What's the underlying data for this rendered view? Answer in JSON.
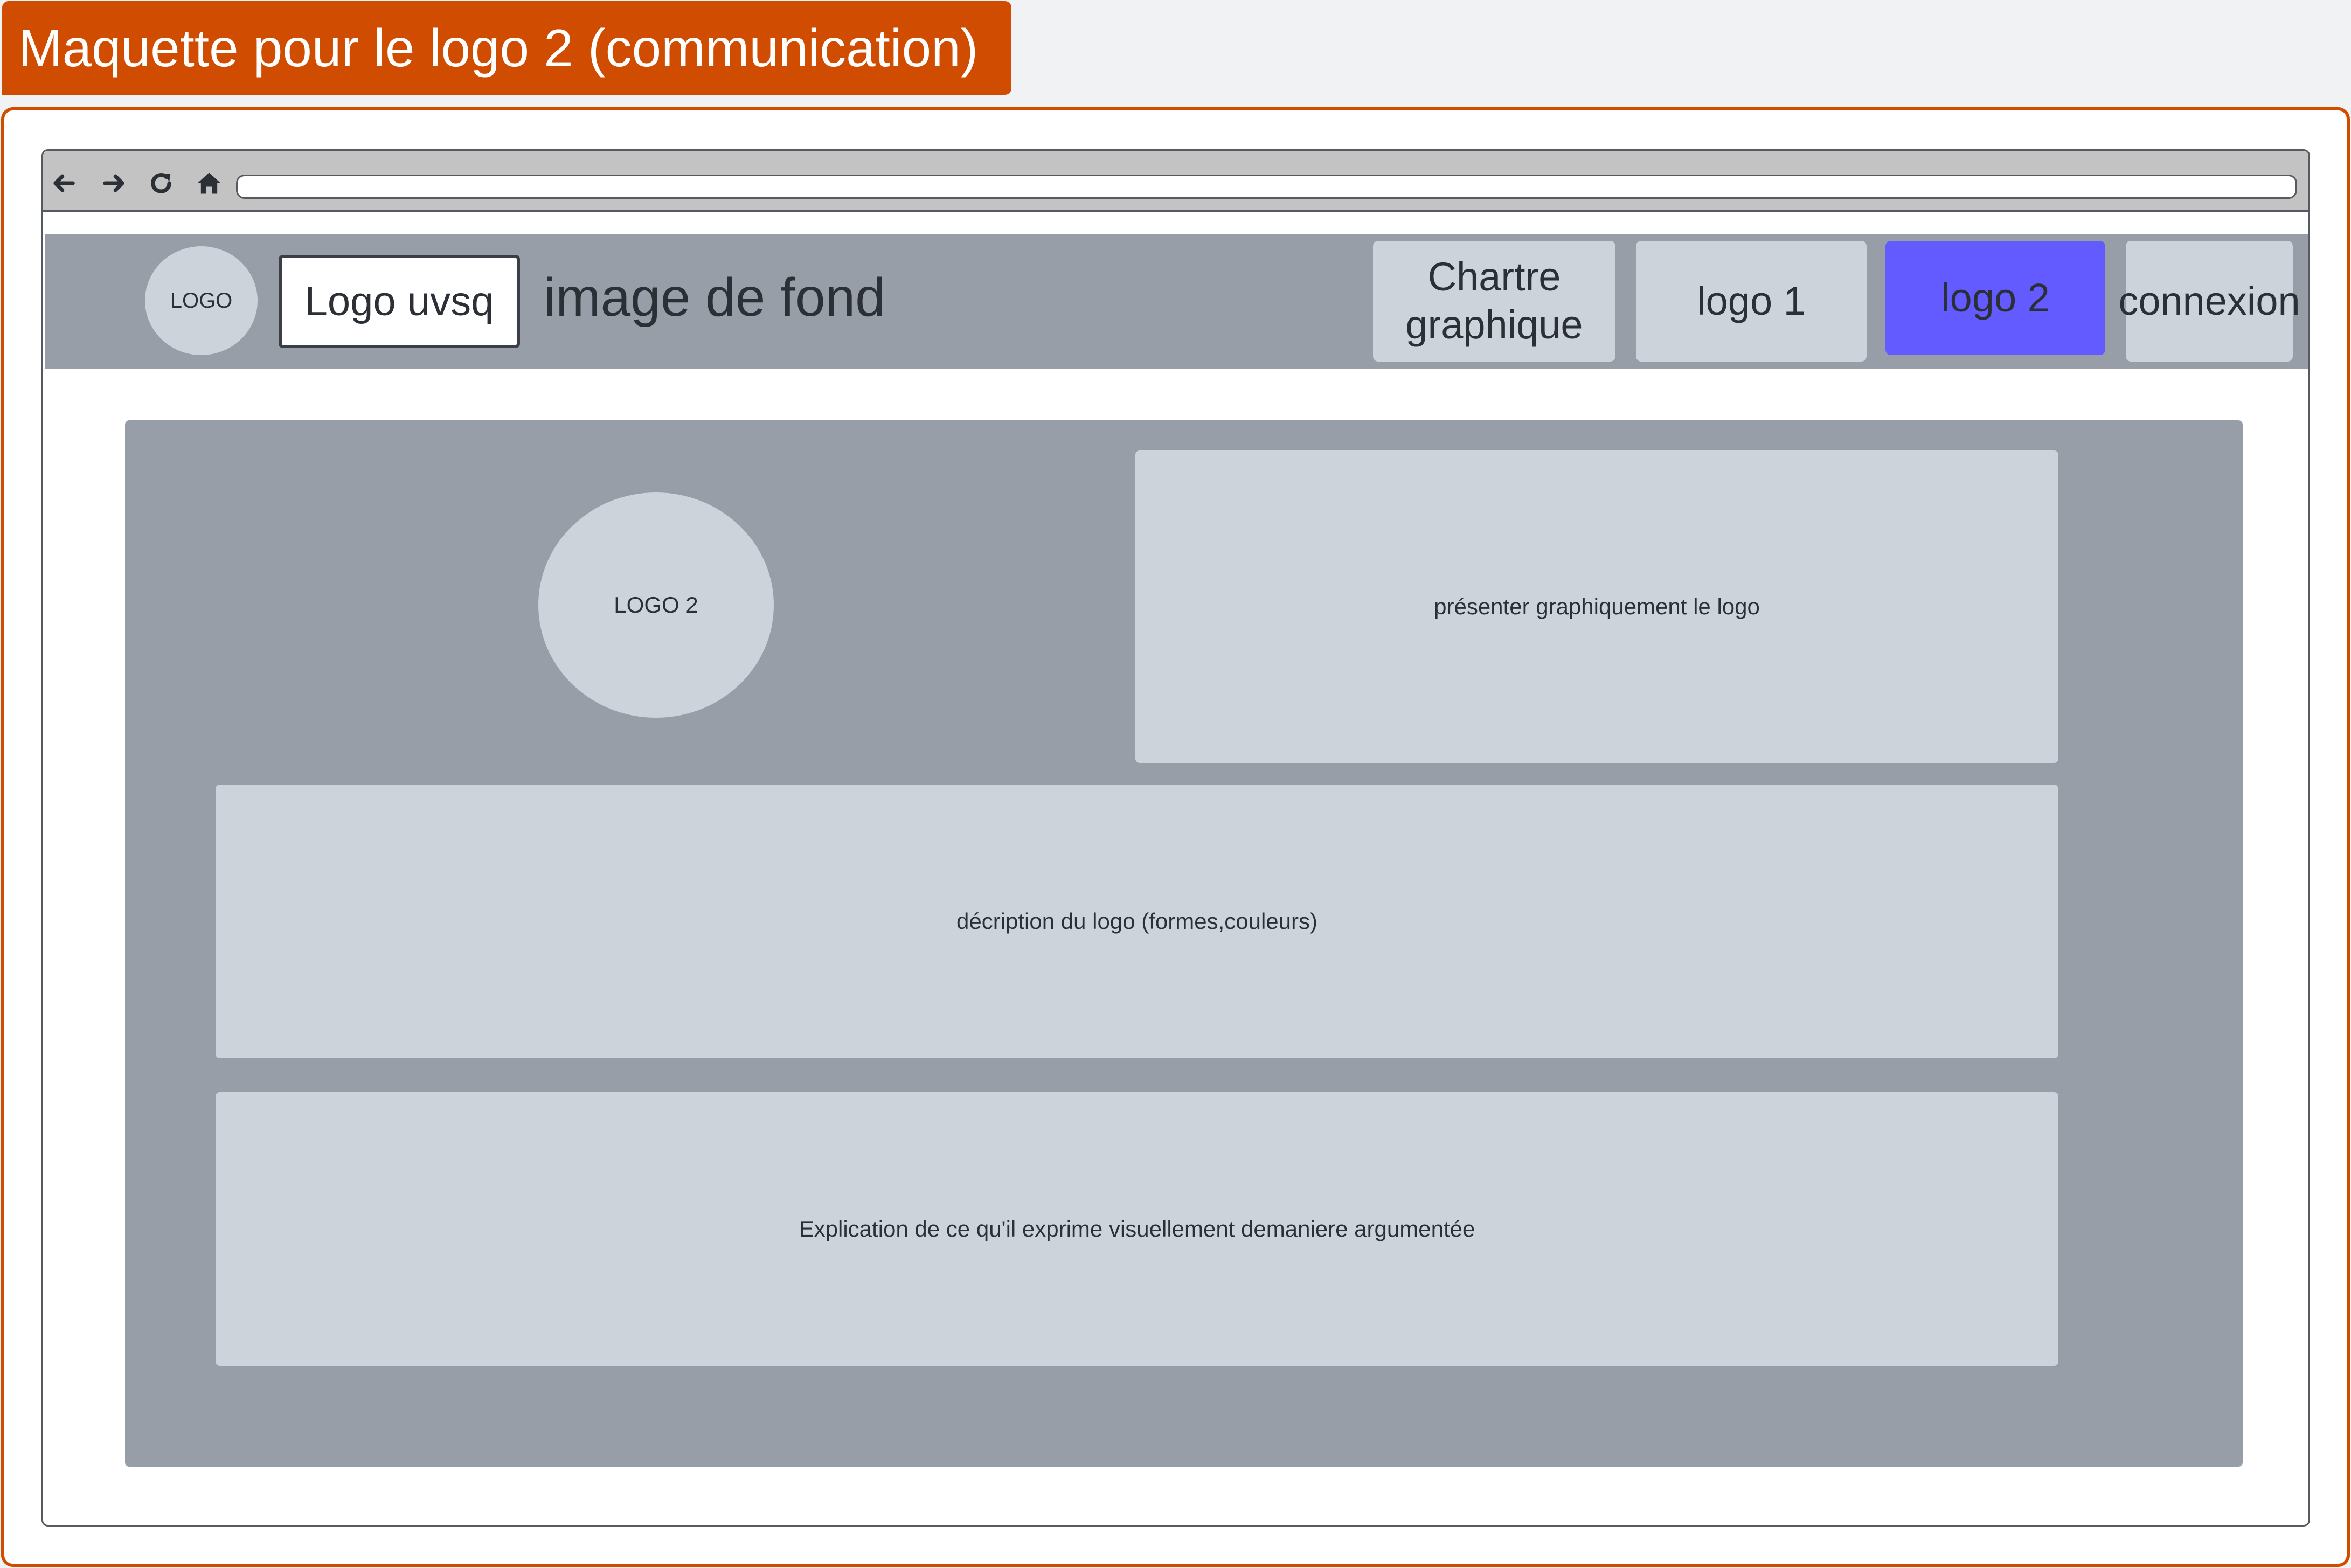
{
  "diagram": {
    "title": "Maquette pour le logo 2 (communication)"
  },
  "browser": {
    "icons": [
      "back-arrow-icon",
      "forward-arrow-icon",
      "reload-icon",
      "home-icon"
    ],
    "address": ""
  },
  "header": {
    "logo_label": "LOGO",
    "logo_uvsq_label": "Logo uvsq",
    "background_label": "image de fond",
    "nav": {
      "chartre_line1": "Chartre",
      "chartre_line2": "graphique",
      "logo1": "logo 1",
      "logo2": "logo 2",
      "connexion": "connexion"
    },
    "active_item": "logo 2"
  },
  "content": {
    "logo2_label": "LOGO 2",
    "present_text": "présenter graphiquement le logo",
    "description_text": "décription du logo (formes,couleurs)",
    "explanation_text": "Explication de ce qu'il exprime visuellement demaniere argumentée"
  },
  "colors": {
    "accent": "#cf4c00",
    "header_bg": "#979ea7",
    "panel_bg": "#cdd3db",
    "active_button": "#635bff",
    "text": "#2b2f36"
  }
}
